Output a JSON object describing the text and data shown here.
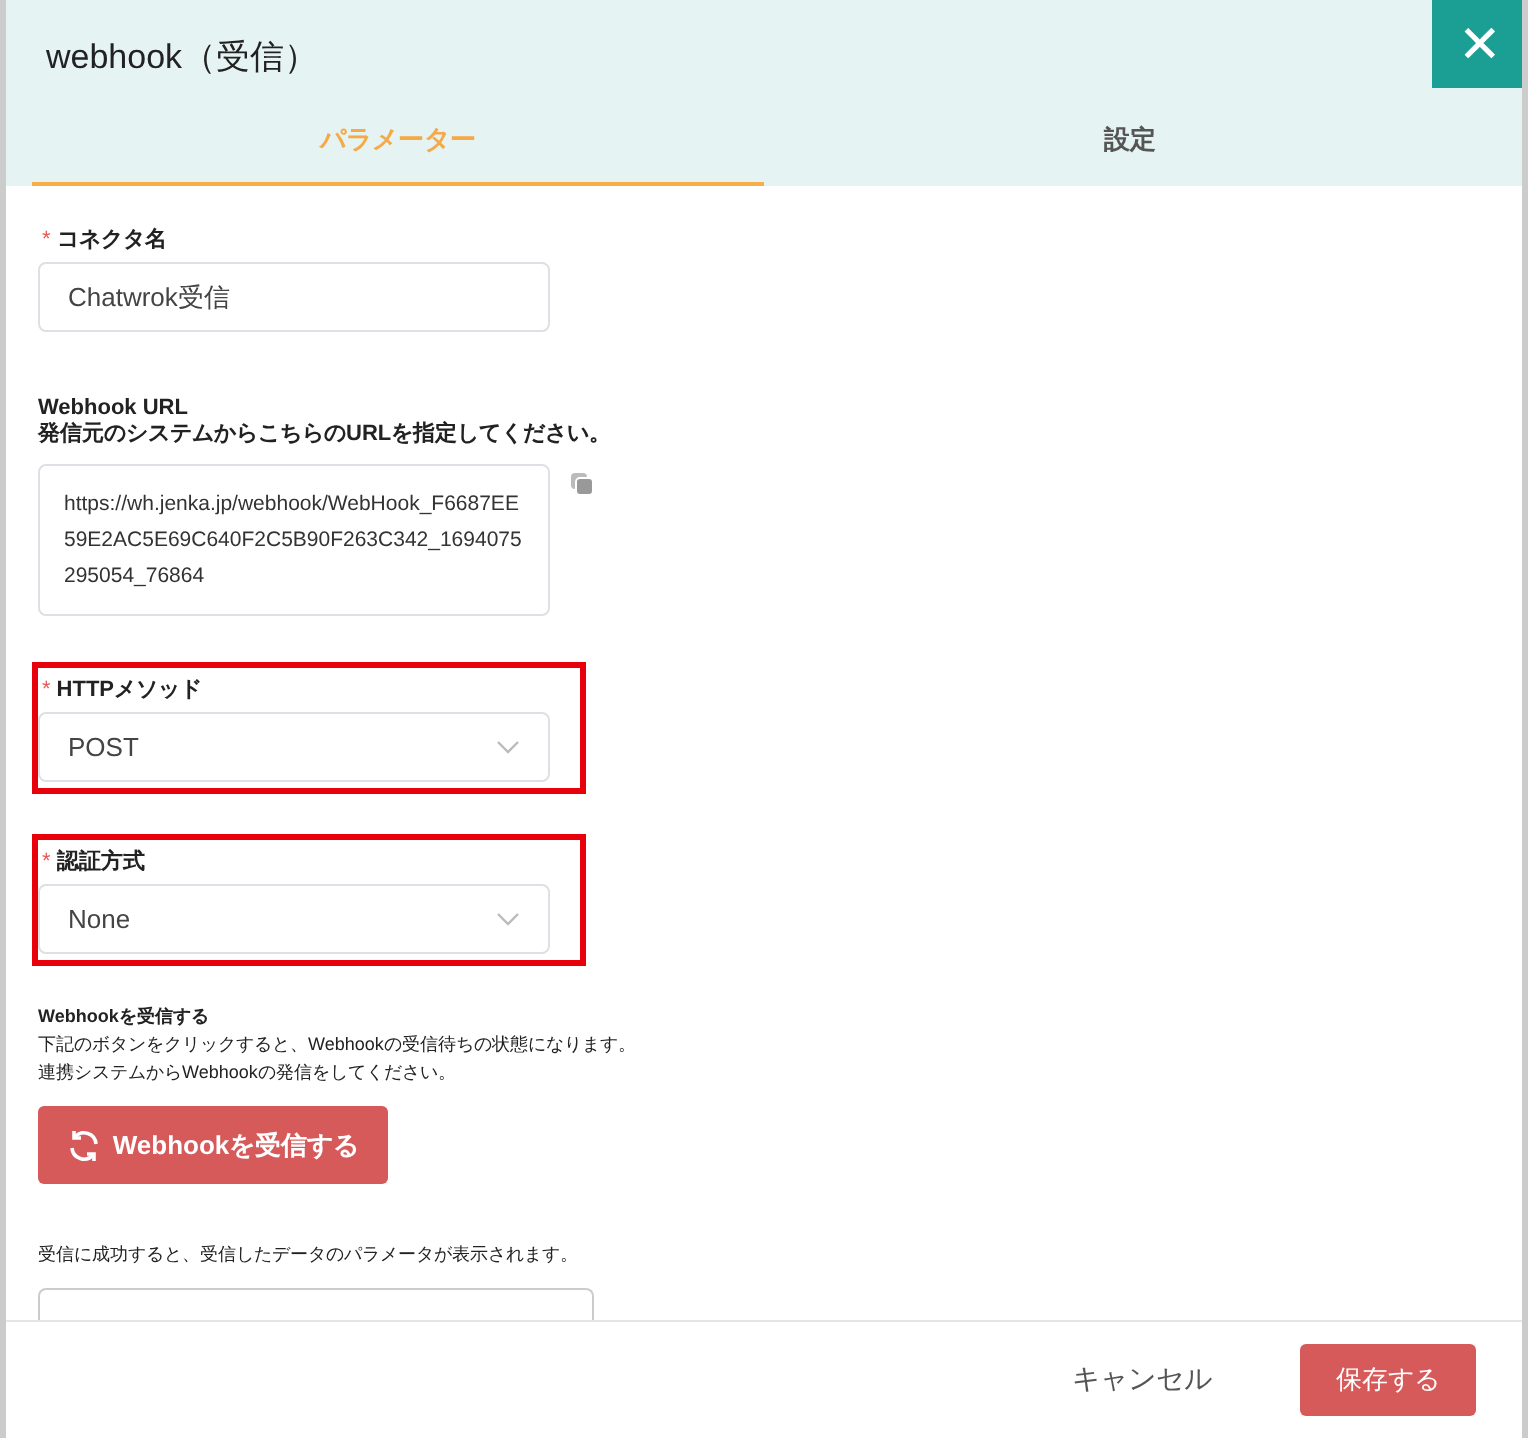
{
  "window": {
    "title": "webhook（受信）",
    "close": "✕"
  },
  "tabs": [
    {
      "label": "パラメーター",
      "selected": true
    },
    {
      "label": "設定",
      "selected": false
    }
  ],
  "fields": [
    {
      "kind": "input",
      "label": "コネクタ名",
      "required_mark": "*",
      "highlighted": false,
      "value": "Chatwrok受信"
    },
    {
      "kind": "url",
      "title": "Webhook URL",
      "hint": "発信元のシステムからこちらのURLを指定してください。",
      "value": "https://wh.jenka.jp/webhook/WebHook_F6687EE59E2AC5E69C640F2C5B90F263C342_1694075295054_76864"
    },
    {
      "kind": "select",
      "label": "HTTPメソッド",
      "required_mark": "*",
      "highlighted": true,
      "value": "POST"
    },
    {
      "kind": "select",
      "label": "認証方式",
      "required_mark": "*",
      "highlighted": true,
      "value": "None"
    }
  ],
  "receive": {
    "title": "Webhookを受信する",
    "lines": [
      "下記のボタンをクリックすると、Webhookの受信待ちの状態になります。",
      "連携システムからWebhookの発信をしてください。"
    ],
    "button": "Webhookを受信する",
    "result_hint": "受信に成功すると、受信したデータのパラメータが表示されます。"
  },
  "footer": {
    "cancel": "キャンセル",
    "save": "保存する"
  }
}
